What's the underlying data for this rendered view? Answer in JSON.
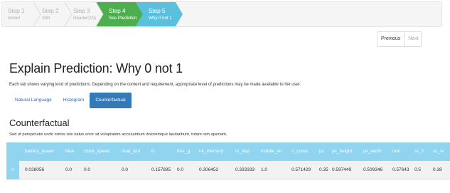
{
  "wizard": {
    "steps": [
      {
        "title": "Step 1",
        "sub": "Model"
      },
      {
        "title": "Step 2",
        "sub": "SIM"
      },
      {
        "title": "Step 3",
        "sub": "Header(2N)"
      },
      {
        "title": "Step 4",
        "sub": "See Prediction"
      },
      {
        "title": "Step 5",
        "sub": "Why 0 not 1"
      }
    ],
    "colors": {
      "inactive": "#f5f5f5",
      "done": "#4cae4c",
      "current": "#5bc0de"
    }
  },
  "pager": {
    "previous": "Previous",
    "next": "Next"
  },
  "page": {
    "title": "Explain Prediction: Why 0 not 1",
    "description": "Each tab shows varying kind of predictions. Depending on the context and requirement, appropriate level of predictions may be made available to the user."
  },
  "tabs": [
    "Natural Language",
    "Histogram",
    "Counterfactual"
  ],
  "section": {
    "title": "Counterfactual",
    "description": "Sed ut perspiciatis unde omnis iste natus error sit voluptatem accusantium doloremque laudantium, totam rem aperiam."
  },
  "table": {
    "columns": [
      "battery_power",
      "blue",
      "clock_speed",
      "dual_sim",
      "fc",
      "four_g",
      "int_memory",
      "m_dep",
      "mobile_wt",
      "n_cores",
      "pc",
      "px_height",
      "px_width",
      "ram",
      "sc_h",
      "sc_w"
    ],
    "row_index": "0",
    "row": [
      "0.028056",
      "0.0",
      "0.0",
      "0.0",
      "0.157895",
      "0.0",
      "0.306452",
      "0.333333",
      "1.0",
      "0.571429",
      "0.35",
      "0.597449",
      "0.509346",
      "0.57643",
      "0.5",
      "0.38"
    ]
  }
}
